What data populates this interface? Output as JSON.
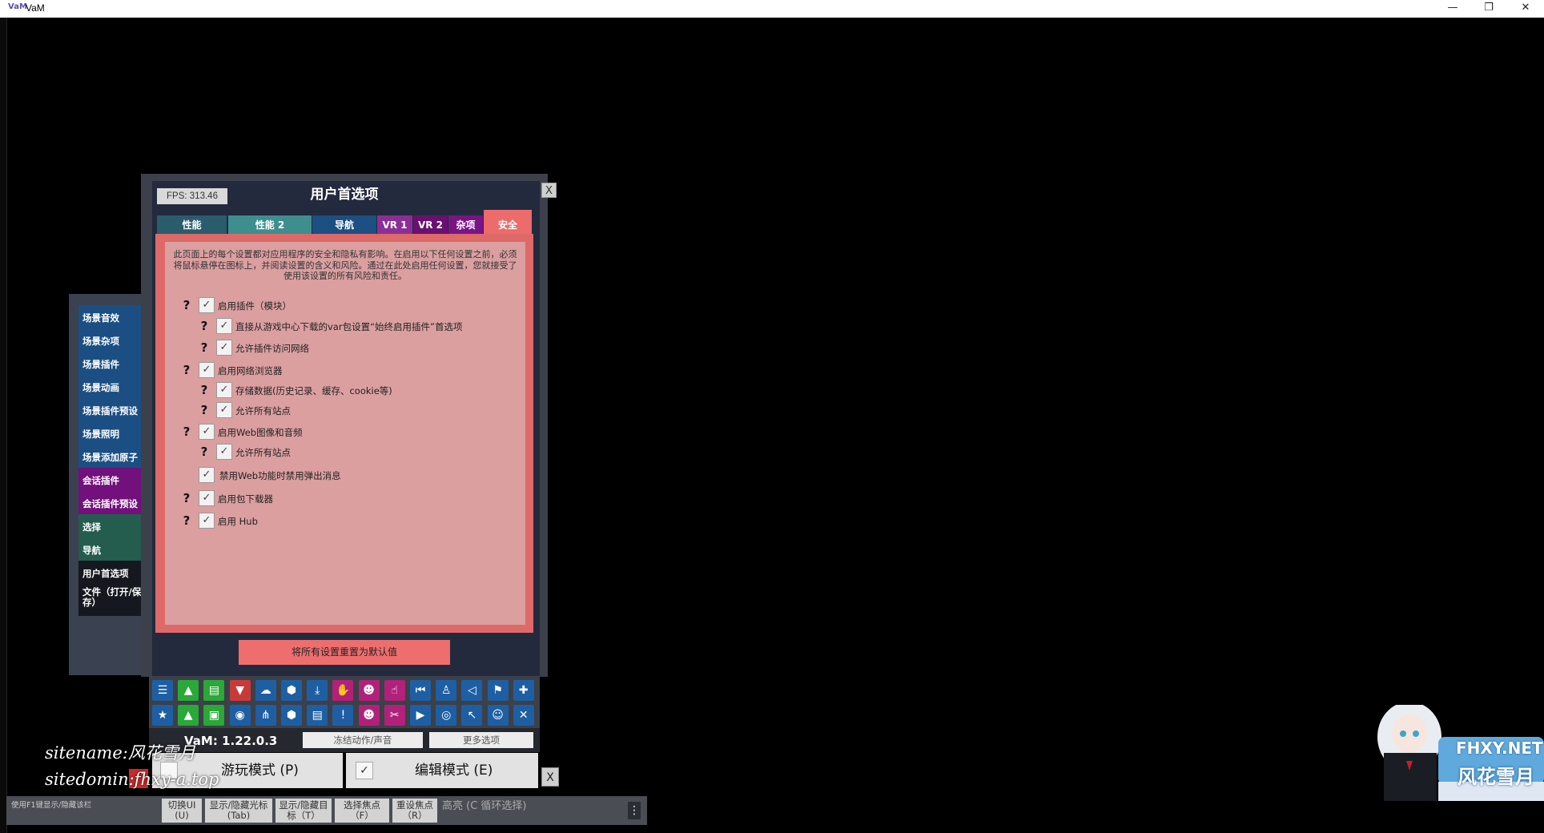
{
  "window": {
    "title": "VaM",
    "controls": [
      "—",
      "❐",
      "✕"
    ]
  },
  "side_menu": [
    {
      "label": "场景音效",
      "style": "s-blue"
    },
    {
      "label": "场景杂项",
      "style": "s-blue"
    },
    {
      "label": "场景插件",
      "style": "s-blue"
    },
    {
      "label": "场景动画",
      "style": "s-blue"
    },
    {
      "label": "场景插件预设",
      "style": "s-blue"
    },
    {
      "label": "场景照明",
      "style": "s-blue"
    },
    {
      "label": "场景添加原子",
      "style": "s-blue"
    },
    {
      "label": "会话插件",
      "style": "s-purple"
    },
    {
      "label": "会话插件预设",
      "style": "s-purple"
    },
    {
      "label": "选择",
      "style": "s-teal"
    },
    {
      "label": "导航",
      "style": "s-teal"
    },
    {
      "label": "用户首选项",
      "style": "s-dark"
    },
    {
      "label": "文件（打开/保存）",
      "style": "s-dark"
    }
  ],
  "panel": {
    "fps": "FPS: 313.46",
    "title": "用户首选项",
    "close": "X",
    "tabs": [
      {
        "label": "性能",
        "color": "#2a5c6c"
      },
      {
        "label": "性能 2",
        "color": "#3f8e8e"
      },
      {
        "label": "导航",
        "color": "#1c4f82"
      },
      {
        "label": "VR 1",
        "color": "#8c2f95"
      },
      {
        "label": "VR 2",
        "color": "#6a1070"
      },
      {
        "label": "杂项",
        "color": "#7a1485"
      },
      {
        "label": "安全",
        "color": "#ec6b6b"
      }
    ],
    "active_tab": "安全",
    "description": "此页面上的每个设置都对应用程序的安全和隐私有影响。在启用以下任何设置之前，必须将鼠标悬停在图标上，并阅读设置的含义和风险。通过在此处启用任何设置，您就接受了使用该设置的所有风险和责任。",
    "options": [
      {
        "label": "启用插件（模块）",
        "checked": true,
        "help": true,
        "level": 0
      },
      {
        "label": "直接从游戏中心下载的var包设置“始终启用插件”首选项",
        "checked": true,
        "help": true,
        "level": 1
      },
      {
        "label": "允许插件访问网络",
        "checked": true,
        "help": true,
        "level": 1
      },
      {
        "label": "启用网络浏览器",
        "checked": true,
        "help": true,
        "level": 0
      },
      {
        "label": "存储数据(历史记录、缓存、cookie等)",
        "checked": true,
        "help": true,
        "level": 1
      },
      {
        "label": "允许所有站点",
        "checked": true,
        "help": true,
        "level": 1
      },
      {
        "label": "启用Web图像和音频",
        "checked": true,
        "help": true,
        "level": 0
      },
      {
        "label": "允许所有站点",
        "checked": true,
        "help": true,
        "level": 1
      },
      {
        "label": "禁用Web功能时禁用弹出消息",
        "checked": true,
        "help": false,
        "level": 0
      },
      {
        "label": "启用包下载器",
        "checked": true,
        "help": true,
        "level": 0
      },
      {
        "label": "启用 Hub",
        "checked": true,
        "help": true,
        "level": 0
      }
    ],
    "reset_button": "将所有设置重置为默认值"
  },
  "toolbar": {
    "row1": [
      {
        "icon": "☰",
        "name": "menu-icon",
        "style": ""
      },
      {
        "icon": "▲",
        "name": "open-scene-icon",
        "style": "t-green"
      },
      {
        "icon": "▤",
        "name": "folder-icon",
        "style": "t-green"
      },
      {
        "icon": "▼",
        "name": "save-scene-icon",
        "style": "t-red"
      },
      {
        "icon": "☁",
        "name": "cloud-icon",
        "style": ""
      },
      {
        "icon": "⬢",
        "name": "package-icon",
        "style": ""
      },
      {
        "icon": "⤓",
        "name": "download-icon",
        "style": ""
      },
      {
        "icon": "✋",
        "name": "hand-icon",
        "style": "t-magenta"
      },
      {
        "icon": "☻",
        "name": "person-add-icon",
        "style": "t-magenta"
      },
      {
        "icon": "☝",
        "name": "pointer-hand-icon",
        "style": "t-magenta"
      },
      {
        "icon": "⏮",
        "name": "rewind-icon",
        "style": ""
      },
      {
        "icon": "♙",
        "name": "person-icon",
        "style": ""
      },
      {
        "icon": "◁",
        "name": "unity-icon",
        "style": ""
      },
      {
        "icon": "⚑",
        "name": "flag-icon",
        "style": ""
      },
      {
        "icon": "✚",
        "name": "add-icon",
        "style": ""
      }
    ],
    "row2": [
      {
        "icon": "★",
        "name": "star-icon",
        "style": ""
      },
      {
        "icon": "▲",
        "name": "open-folder-icon",
        "style": "t-green"
      },
      {
        "icon": "▣",
        "name": "add-folder-icon",
        "style": "t-green"
      },
      {
        "icon": "◉",
        "name": "camera-icon",
        "style": ""
      },
      {
        "icon": "⋔",
        "name": "hierarchy-icon",
        "style": ""
      },
      {
        "icon": "⬢",
        "name": "package-settings-icon",
        "style": ""
      },
      {
        "icon": "▤",
        "name": "document-icon",
        "style": ""
      },
      {
        "icon": "!",
        "name": "alert-icon",
        "style": ""
      },
      {
        "icon": "☻",
        "name": "person-remove-icon",
        "style": "t-magenta"
      },
      {
        "icon": "✂",
        "name": "tool-icon",
        "style": "t-magenta"
      },
      {
        "icon": "▶",
        "name": "play-icon",
        "style": ""
      },
      {
        "icon": "◎",
        "name": "target-icon",
        "style": ""
      },
      {
        "icon": "↖",
        "name": "cursor-icon",
        "style": ""
      },
      {
        "icon": "☺",
        "name": "people-icon",
        "style": ""
      },
      {
        "icon": "✕",
        "name": "tools-icon",
        "style": ""
      }
    ]
  },
  "version": "VaM: 1.22.0.3",
  "freeze_button": "冻结动作/声音",
  "more_options": "更多选项",
  "play_mode": {
    "label": "游玩模式 (P)",
    "checked": false
  },
  "edit_mode": {
    "label": "编辑模式 (E)",
    "checked": true
  },
  "mode_close": "X",
  "bottom_bar": {
    "hint": "使用F1键显示/隐藏该栏",
    "buttons": [
      {
        "line1": "切换UI",
        "line2": "(U)"
      },
      {
        "line1": "显示/隐藏光标",
        "line2": "(Tab)"
      },
      {
        "line1": "显示/隐藏目",
        "line2": "标（T）"
      },
      {
        "line1": "选择焦点",
        "line2": "（F）"
      },
      {
        "line1": "重设焦点",
        "line2": "（R）"
      }
    ],
    "highlight": "高亮 (C 循环选择)",
    "more": "⋮"
  },
  "watermarks": {
    "sitename": "sitename:风花雪月",
    "sitedomin": "sitedomin:fhxy-a.top",
    "logo_top": "FHXY.NET",
    "logo_bottom": "风花雪月"
  }
}
